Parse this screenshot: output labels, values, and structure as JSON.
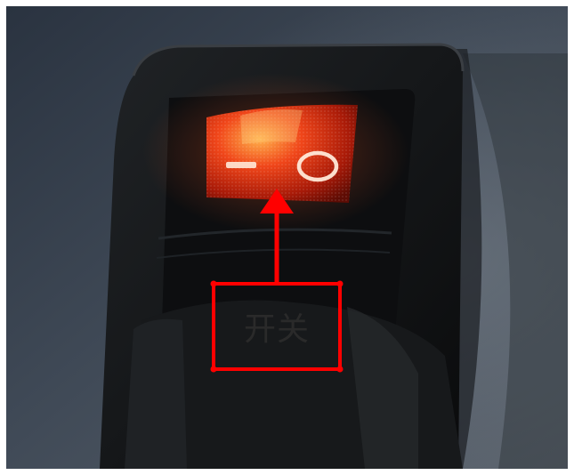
{
  "annotation": {
    "label": "开关",
    "color": "#ff0000"
  },
  "switch": {
    "off_symbol": "O",
    "on_symbol": "—",
    "glow_color": "#ff3a10"
  },
  "scene": {
    "background": "#3b4450",
    "panel_color": "#121416"
  }
}
